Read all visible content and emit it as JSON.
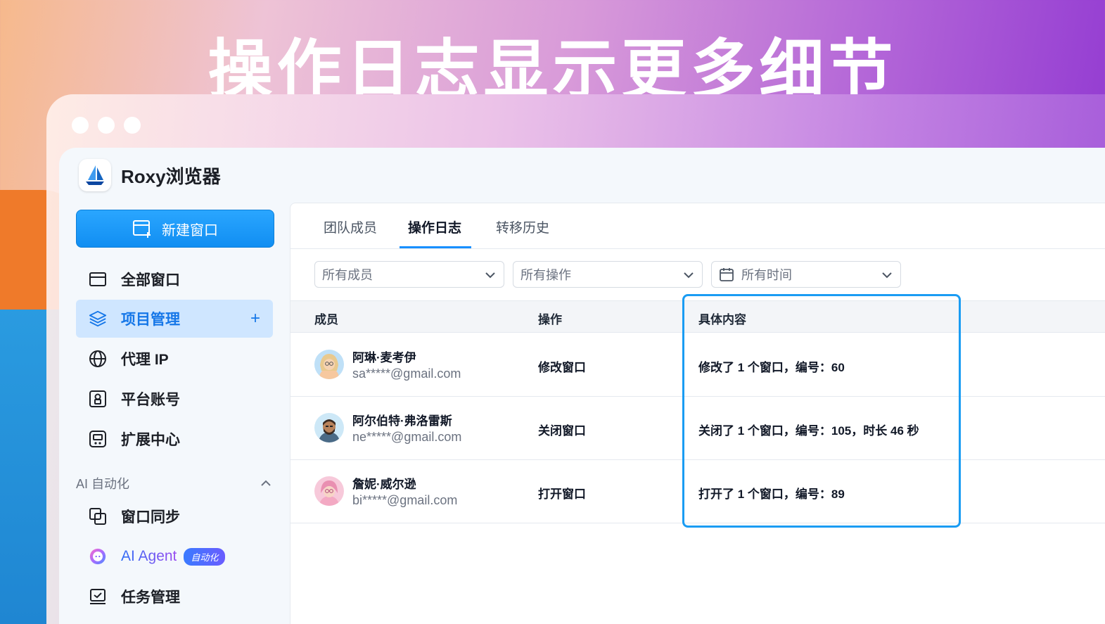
{
  "headline": "操作日志显示更多细节",
  "brand": {
    "name": "Roxy浏览器"
  },
  "sidebar": {
    "new_window_label": "新建窗口",
    "items": [
      {
        "label": "全部窗口",
        "icon": "window-icon"
      },
      {
        "label": "项目管理",
        "icon": "layers-icon",
        "active": true
      },
      {
        "label": "代理 IP",
        "icon": "globe-icon"
      },
      {
        "label": "平台账号",
        "icon": "account-icon"
      },
      {
        "label": "扩展中心",
        "icon": "extension-icon"
      }
    ],
    "section_label": "AI 自动化",
    "ai_items": [
      {
        "label": "窗口同步",
        "icon": "sync-icon"
      },
      {
        "label": "AI Agent",
        "icon": "agent-icon",
        "badge": "自动化"
      },
      {
        "label": "任务管理",
        "icon": "task-icon"
      }
    ],
    "add_symbol": "+"
  },
  "tabs": [
    {
      "label": "团队成员"
    },
    {
      "label": "操作日志",
      "active": true
    },
    {
      "label": "转移历史"
    }
  ],
  "filters": {
    "member": "所有成员",
    "operation": "所有操作",
    "time": "所有时间"
  },
  "table": {
    "headers": {
      "member": "成员",
      "operation": "操作",
      "detail": "具体内容"
    },
    "rows": [
      {
        "name": "阿琳·麦考伊",
        "email": "sa*****@gmail.com",
        "operation": "修改窗口",
        "detail": "修改了 1 个窗口，编号：60"
      },
      {
        "name": "阿尔伯特·弗洛雷斯",
        "email": "ne*****@gmail.com",
        "operation": "关闭窗口",
        "detail": "关闭了 1 个窗口，编号：105，时长 46 秒"
      },
      {
        "name": "詹妮·威尔逊",
        "email": "bi*****@gmail.com",
        "operation": "打开窗口",
        "detail": "打开了 1 个窗口，编号：89"
      }
    ]
  },
  "colors": {
    "accent": "#1890ff",
    "highlight_border": "#1a9cf3",
    "active_nav_bg": "#cfe6ff"
  }
}
